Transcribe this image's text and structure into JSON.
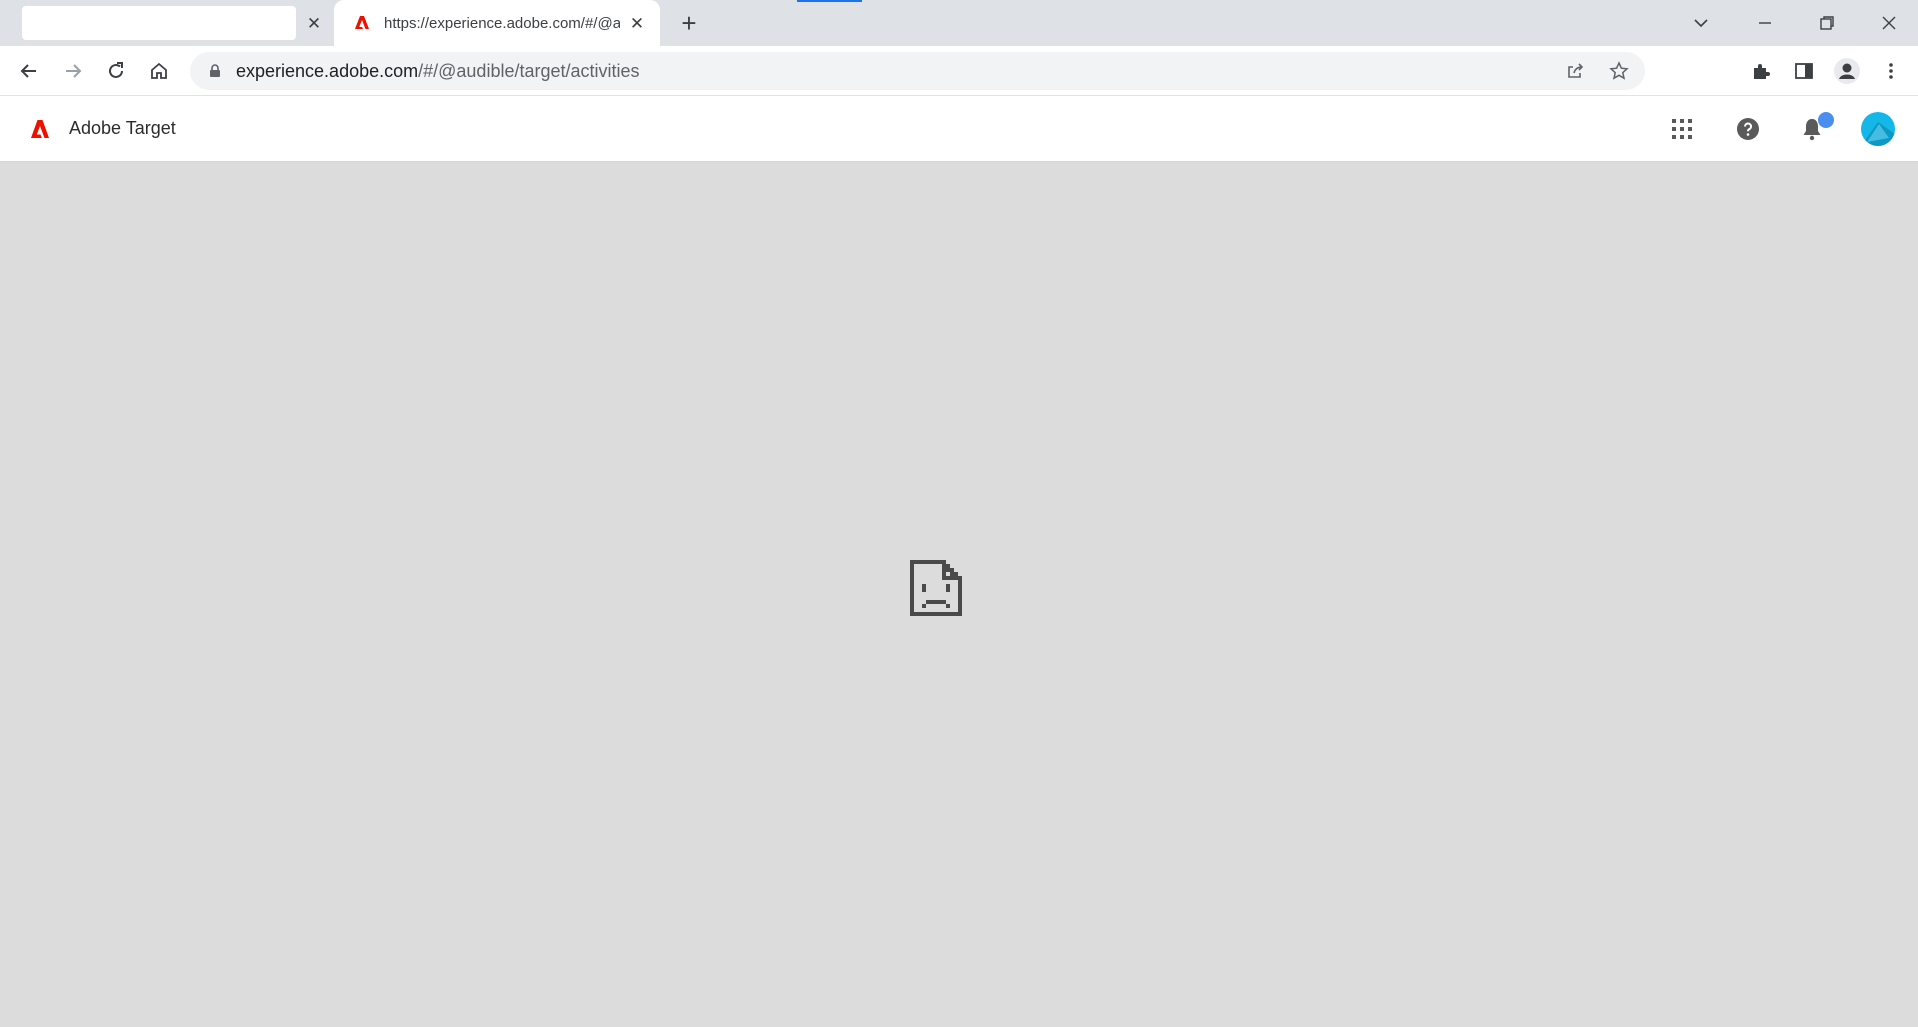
{
  "browser": {
    "tabs": [
      {
        "label": ""
      },
      {
        "label": "https://experience.adobe.com/#/@audible/target/activities"
      }
    ],
    "address": {
      "host": "experience.adobe.com",
      "path": "/#/@audible/target/activities"
    }
  },
  "app": {
    "product_name": "Adobe Target"
  },
  "colors": {
    "adobe_red": "#eb1000",
    "notification_dot": "#4a8ff0",
    "avatar": "#14b8e8",
    "content_bg": "#dcdcdc"
  },
  "icons": {
    "content": "sad-page-icon"
  }
}
